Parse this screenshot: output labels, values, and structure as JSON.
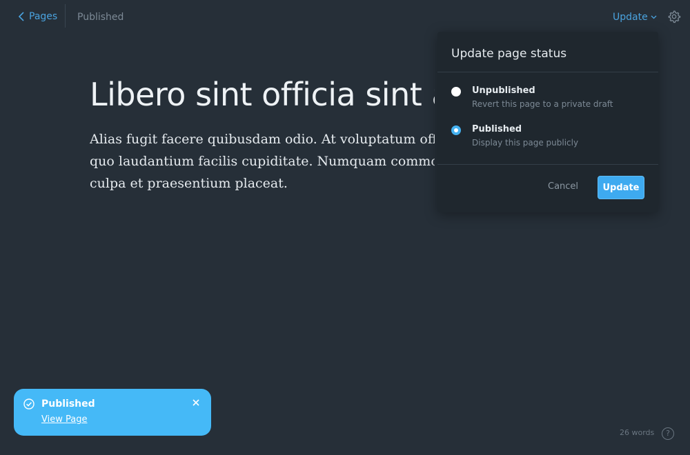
{
  "topbar": {
    "back_label": "Pages",
    "status_label": "Published",
    "update_label": "Update"
  },
  "editor": {
    "title": "Libero sint officia sint a",
    "body_lines": [
      "Alias fugit facere quibusdam odio. At voluptatum officia",
      "quo laudantium facilis cupiditate. Numquam commodi e",
      "culpa et praesentium placeat."
    ]
  },
  "popover": {
    "title": "Update page status",
    "options": [
      {
        "label": "Unpublished",
        "description": "Revert this page to a private draft",
        "selected": false
      },
      {
        "label": "Published",
        "description": "Display this page publicly",
        "selected": true
      }
    ],
    "cancel_label": "Cancel",
    "confirm_label": "Update"
  },
  "toast": {
    "title": "Published",
    "link_label": "View Page"
  },
  "footer": {
    "word_count": "26 words",
    "help_label": "?"
  },
  "colors": {
    "background": "#262f38",
    "accent": "#4aa3df",
    "toast": "#45b9f7"
  }
}
